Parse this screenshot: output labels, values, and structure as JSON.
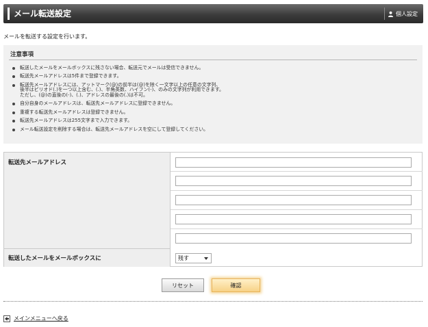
{
  "header": {
    "title": "メール転送設定",
    "settings_label": "個人設定",
    "settings_icon": "person-icon"
  },
  "intro": "メールを転送する設定を行います。",
  "notice": {
    "title": "注意事項",
    "items": [
      "転送したメールをメールボックスに残さない場合、転送元でメールは受信できません。",
      "転送先メールアドレスは5件まで登録できます。",
      "転送先メールアドレスには、アットマーク(@)の前半は(@)を除く一文字以上の任意の文字列、\n後半はピリオド(.)を一つ以上含む、(.)、半角英数、ハイフン(-)、のみの文字列が利用できます。\nただし、(@)の直後の(-)、(.)、アドレスの最後の(.)は不可。",
      "自分自身のメールアドレスは、転送先メールアドレスに登録できません。",
      "重複する転送先メールアドレスは登録できません。",
      "転送先メールアドレスは255文字まで入力できます。",
      "メール転送設定を削除する場合は、転送先メールアドレスを空にして登録してください。"
    ]
  },
  "form": {
    "address_label": "転送先メールアドレス",
    "addresses": [
      "",
      "",
      "",
      "",
      ""
    ],
    "keep_label": "転送したメールをメールボックスに",
    "keep_value": "残す"
  },
  "buttons": {
    "reset": "リセット",
    "confirm": "確認"
  },
  "back_link": "メインメニューへ戻る"
}
